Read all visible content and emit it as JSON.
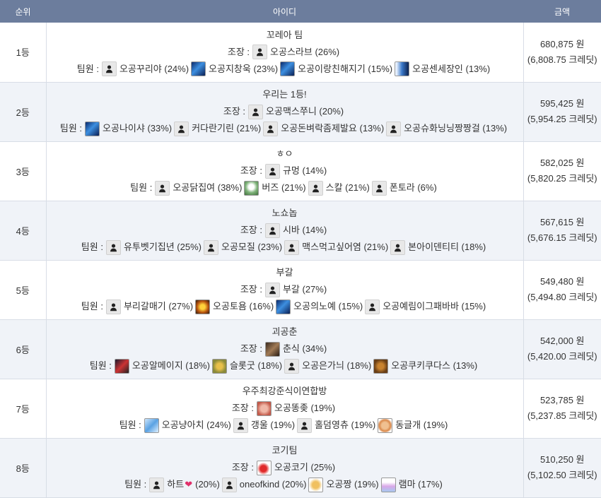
{
  "header": {
    "rank": "순위",
    "id": "아이디",
    "amount": "금액"
  },
  "labels": {
    "leader": "조장 :",
    "members": "팀원 :"
  },
  "colors": {
    "header_bg": "#6c7d9d",
    "row_alt": "#f0f3f8"
  },
  "rows": [
    {
      "rank": "1등",
      "team": "꼬레아 팀",
      "leader": {
        "name": "오공스라브 (26%)",
        "avatar": "user"
      },
      "members": [
        {
          "name": "오공꾸리야 (24%)",
          "avatar": "user"
        },
        {
          "name": "오공지창욱 (23%)",
          "avatar": "blue"
        },
        {
          "name": "오공이랑친해지기 (15%)",
          "avatar": "blue"
        },
        {
          "name": "오공센세장인 (13%)",
          "avatar": "blue2"
        }
      ],
      "amount": "680,875 원",
      "credits": "(6,808.75 크레딧)"
    },
    {
      "rank": "2등",
      "team": "우리는 1등!",
      "leader": {
        "name": "오공맥스쭈니 (20%)",
        "avatar": "user"
      },
      "members": [
        {
          "name": "오공나이샤 (33%)",
          "avatar": "blue"
        },
        {
          "name": "커다란기린 (21%)",
          "avatar": "user"
        },
        {
          "name": "오공돈벼락좀제발요 (13%)",
          "avatar": "user"
        },
        {
          "name": "오공슈화닝닝짱짱걸 (13%)",
          "avatar": "user"
        }
      ],
      "amount": "595,425 원",
      "credits": "(5,954.25 크레딧)"
    },
    {
      "rank": "3등",
      "team": "ㅎㅇ",
      "leader": {
        "name": "규멍 (14%)",
        "avatar": "user"
      },
      "members": [
        {
          "name": "오공닭집여 (38%)",
          "avatar": "user"
        },
        {
          "name": "버즈 (21%)",
          "avatar": "green"
        },
        {
          "name": "스칼 (21%)",
          "avatar": "user"
        },
        {
          "name": "폰토라 (6%)",
          "avatar": "user"
        }
      ],
      "amount": "582,025 원",
      "credits": "(5,820.25 크레딧)"
    },
    {
      "rank": "4등",
      "team": "노쇼놉",
      "leader": {
        "name": "시바 (14%)",
        "avatar": "user"
      },
      "members": [
        {
          "name": "유투벳기집년 (25%)",
          "avatar": "user"
        },
        {
          "name": "오공모질 (23%)",
          "avatar": "user"
        },
        {
          "name": "맥스먹고싶어염 (21%)",
          "avatar": "user"
        },
        {
          "name": "본아이덴티티 (18%)",
          "avatar": "user"
        }
      ],
      "amount": "567,615 원",
      "credits": "(5,676.15 크레딧)"
    },
    {
      "rank": "5등",
      "team": "부갈",
      "leader": {
        "name": "부갈 (27%)",
        "avatar": "user"
      },
      "members": [
        {
          "name": "부리갈매기 (27%)",
          "avatar": "user"
        },
        {
          "name": "오공토욤 (16%)",
          "avatar": "gold"
        },
        {
          "name": "오공의노예 (15%)",
          "avatar": "blue"
        },
        {
          "name": "오공예림이그패바바 (15%)",
          "avatar": "user"
        }
      ],
      "amount": "549,480 원",
      "credits": "(5,494.80 크레딧)"
    },
    {
      "rank": "6등",
      "team": "괴공춘",
      "leader": {
        "name": "춘식 (34%)",
        "avatar": "brown"
      },
      "members": [
        {
          "name": "오공알메이지 (18%)",
          "avatar": "dark"
        },
        {
          "name": "슬롯굿 (18%)",
          "avatar": "olive"
        },
        {
          "name": "오공은가늬 (18%)",
          "avatar": "user"
        },
        {
          "name": "오공쿠키쿠다스 (13%)",
          "avatar": "cookie"
        }
      ],
      "amount": "542,000 원",
      "credits": "(5,420.00 크레딧)"
    },
    {
      "rank": "7등",
      "team": "우주최강준식이연합방",
      "leader": {
        "name": "오공똥좆 (19%)",
        "avatar": "pink"
      },
      "members": [
        {
          "name": "오공냥아치 (24%)",
          "avatar": "lightblue"
        },
        {
          "name": "갱울 (19%)",
          "avatar": "user"
        },
        {
          "name": "홀덤영츄 (19%)",
          "avatar": "user"
        },
        {
          "name": "동글개 (19%)",
          "avatar": "dog"
        }
      ],
      "amount": "523,785 원",
      "credits": "(5,237.85 크레딧)"
    },
    {
      "rank": "8등",
      "team": "코기팀",
      "leader": {
        "name": "오공코기 (25%)",
        "avatar": "red"
      },
      "members": [
        {
          "name": "하트",
          "heart": "❤",
          "pct": "(20%)",
          "avatar": "user"
        },
        {
          "name": "oneofkind (20%)",
          "avatar": "user"
        },
        {
          "name": "오공짱 (19%)",
          "avatar": "hand"
        },
        {
          "name": "램마 (17%)",
          "avatar": "wave"
        }
      ],
      "amount": "510,250 원",
      "credits": "(5,102.50 크레딧)"
    }
  ]
}
